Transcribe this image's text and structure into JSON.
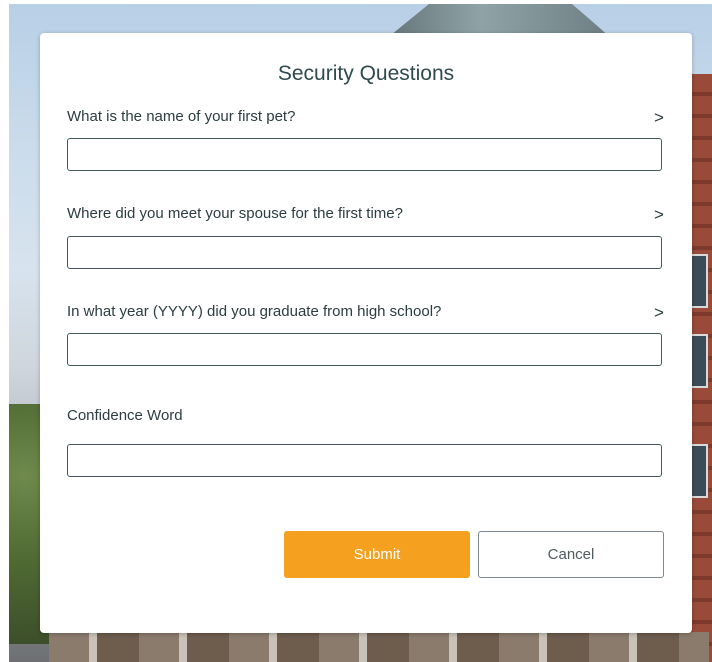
{
  "dialog": {
    "title": "Security Questions",
    "questions": [
      {
        "label": "What is the name of your first pet?",
        "value": "",
        "has_chevron": true
      },
      {
        "label": "Where did you meet your spouse for the first time?",
        "value": "",
        "has_chevron": true
      },
      {
        "label": "In what year (YYYY) did you graduate from high school?",
        "value": "",
        "has_chevron": true
      },
      {
        "label": "Confidence Word",
        "value": "",
        "has_chevron": false
      }
    ],
    "chevron_glyph": ">",
    "submit_label": "Submit",
    "cancel_label": "Cancel"
  },
  "colors": {
    "accent": "#f5a01f",
    "text": "#2b3d40",
    "title": "#2f4a4f",
    "field_border": "#44585c"
  },
  "icons": {
    "chevron": "chevron-right-icon"
  }
}
